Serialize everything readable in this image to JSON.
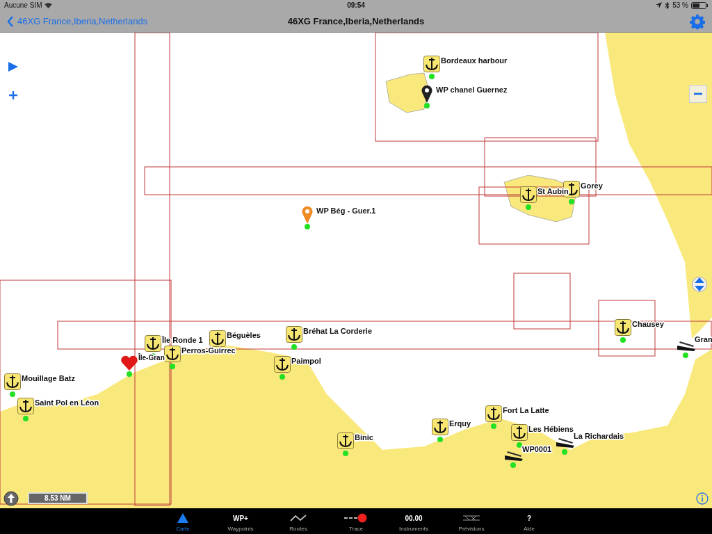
{
  "status_bar": {
    "carrier": "Aucune SIM",
    "time": "09:54",
    "battery": "53 %"
  },
  "nav_bar": {
    "back": "46XG France,Iberia,Netherlands",
    "title": "46XG France,Iberia,Netherlands"
  },
  "map": {
    "kind": "picture",
    "scale": "8.53 NM",
    "markers": [
      {
        "kind": "anchor",
        "label": "Bordeaux harbour"
      },
      {
        "kind": "pin",
        "color": "#222222",
        "label": "WP chanel Guernez"
      },
      {
        "kind": "anchor",
        "label": "St Aubin"
      },
      {
        "kind": "anchor",
        "label": "Gorey"
      },
      {
        "kind": "pin",
        "color": "#f08a24",
        "label": "WP Bég - Guer.1"
      },
      {
        "kind": "anchor",
        "label": "Chausey"
      },
      {
        "kind": "boat",
        "label": "Gran"
      },
      {
        "kind": "anchor",
        "label": "Bréhat La Corderie"
      },
      {
        "kind": "anchor",
        "label": "Béguèles"
      },
      {
        "kind": "anchor",
        "label": "Île Ronde 1"
      },
      {
        "kind": "heart",
        "label": "Île-Gran"
      },
      {
        "kind": "anchor",
        "label": "Perros-Guirrec"
      },
      {
        "kind": "anchor",
        "label": "Paimpol"
      },
      {
        "kind": "anchor",
        "label": "Mouillage Batz"
      },
      {
        "kind": "anchor",
        "label": "Saint Pol en Léon"
      },
      {
        "kind": "anchor",
        "label": "Binic"
      },
      {
        "kind": "anchor",
        "label": "Erquy"
      },
      {
        "kind": "anchor",
        "label": "Fort La Latte"
      },
      {
        "kind": "anchor",
        "label": "Les Hébiens"
      },
      {
        "kind": "boat",
        "label": "La Richardais"
      },
      {
        "kind": "boat",
        "label": "WP0001"
      }
    ]
  },
  "tabs": [
    {
      "kind": "triangle",
      "label": "Carte",
      "selected": true
    },
    {
      "kind": "text",
      "glyph": "WP+",
      "label": "Waypoints",
      "selected": false
    },
    {
      "kind": "zigzag",
      "label": "Routes",
      "selected": false
    },
    {
      "kind": "trace",
      "label": "Trace",
      "selected": false
    },
    {
      "kind": "text",
      "glyph": "00.00",
      "label": "Instruments",
      "selected": false
    },
    {
      "kind": "forecast",
      "label": "Prévisions",
      "selected": false
    },
    {
      "kind": "text",
      "glyph": "?",
      "label": "Aide",
      "selected": false
    }
  ]
}
